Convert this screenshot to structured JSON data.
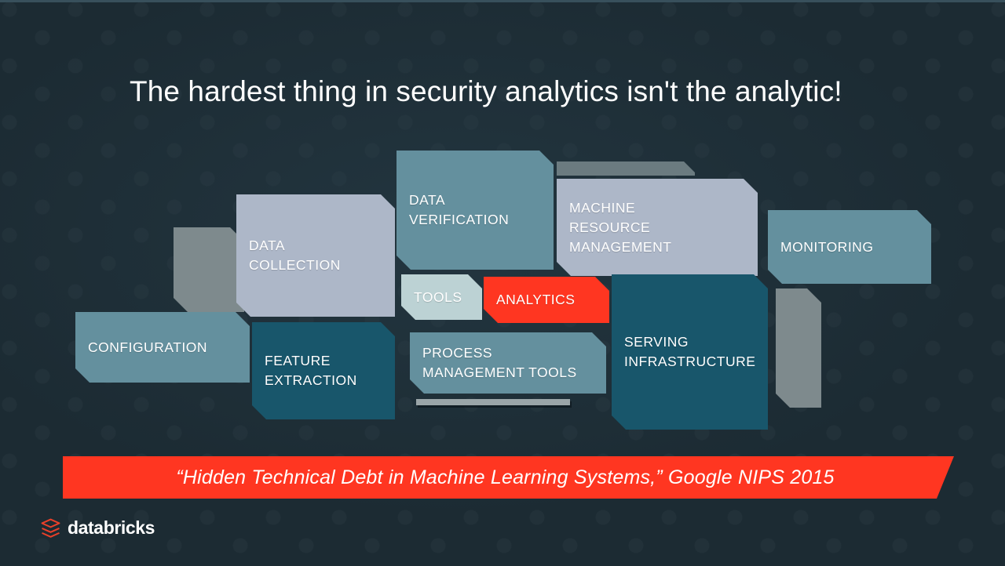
{
  "slide": {
    "title": "The hardest thing in security analytics isn't the analytic!",
    "citation": "“Hidden Technical Debt in Machine Learning Systems,” Google NIPS 2015",
    "brand": "databricks",
    "colors": {
      "background": "#1c2b33",
      "accent_red": "#ff3621",
      "light_gray_blue": "#adb7c8",
      "mid_teal": "#64909e",
      "dark_teal": "#18566b",
      "pale_teal": "#bcd2d4",
      "gray": "#7e8a8d",
      "text": "#ffffff"
    }
  },
  "diagram": {
    "name": "ml-systems-hidden-technical-debt-diagram",
    "boxes": [
      {
        "id": "configuration",
        "label": "CONFIGURATION",
        "color": "#64909e"
      },
      {
        "id": "data-collection",
        "label": "DATA\nCOLLECTION",
        "color": "#adb7c8"
      },
      {
        "id": "feature-extraction",
        "label": "FEATURE\nEXTRACTION",
        "color": "#18566b"
      },
      {
        "id": "data-verification",
        "label": "DATA\nVERIFICATION",
        "color": "#64909e"
      },
      {
        "id": "tools",
        "label": "TOOLS",
        "color": "#bcd2d4"
      },
      {
        "id": "analytics",
        "label": "ANALYTICS",
        "color": "#ff3621"
      },
      {
        "id": "process-management-tools",
        "label": "PROCESS\nMANAGEMENT TOOLS",
        "color": "#64909e"
      },
      {
        "id": "machine-resource-management",
        "label": "MACHINE\nRESOURCE\nMANAGEMENT",
        "color": "#adb7c8"
      },
      {
        "id": "serving-infrastructure",
        "label": "SERVING\nINFRASTRUCTURE",
        "color": "#18566b"
      },
      {
        "id": "monitoring",
        "label": "MONITORING",
        "color": "#64909e"
      }
    ],
    "accents": [
      {
        "id": "accent-block-left",
        "color": "#7e8a8d"
      },
      {
        "id": "accent-bar-top",
        "color": "#6b7b80"
      },
      {
        "id": "accent-bar-bottom",
        "color": "#9aa5a8"
      },
      {
        "id": "accent-block-right",
        "color": "#7e8a8d"
      }
    ]
  }
}
